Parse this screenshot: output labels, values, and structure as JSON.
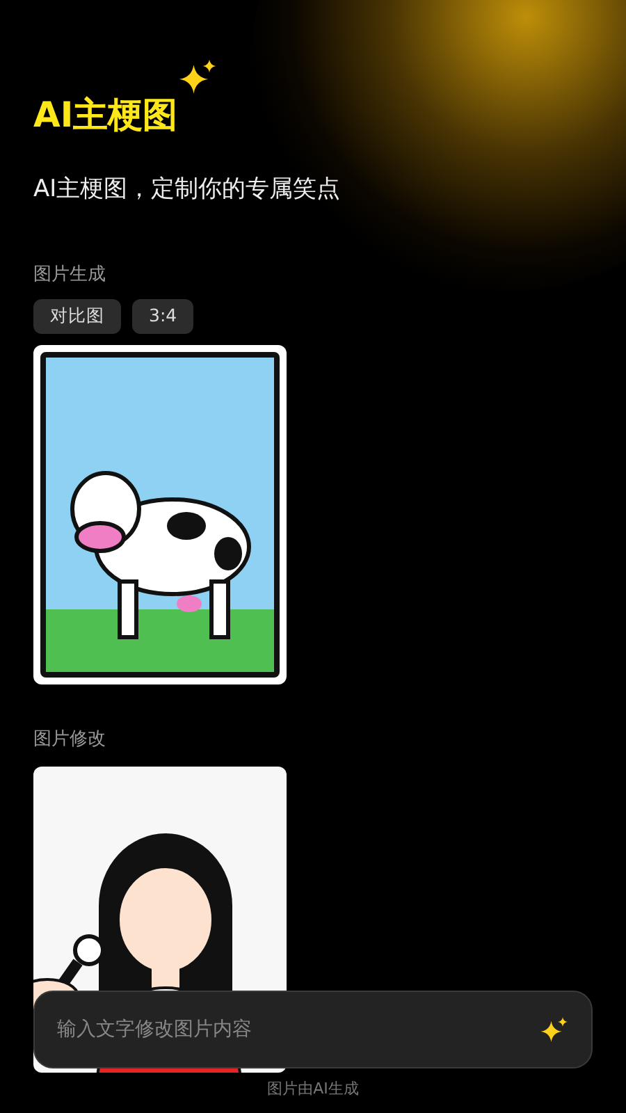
{
  "header": {
    "title": "AI主梗图",
    "subtitle": "AI主梗图，定制你的专属笑点"
  },
  "sections": [
    {
      "label": "图片生成",
      "tags": [
        "对比图",
        "3:4"
      ]
    },
    {
      "label": "图片修改"
    }
  ],
  "input": {
    "placeholder": "输入文字修改图片内容"
  },
  "footer": "图片由AI生成"
}
